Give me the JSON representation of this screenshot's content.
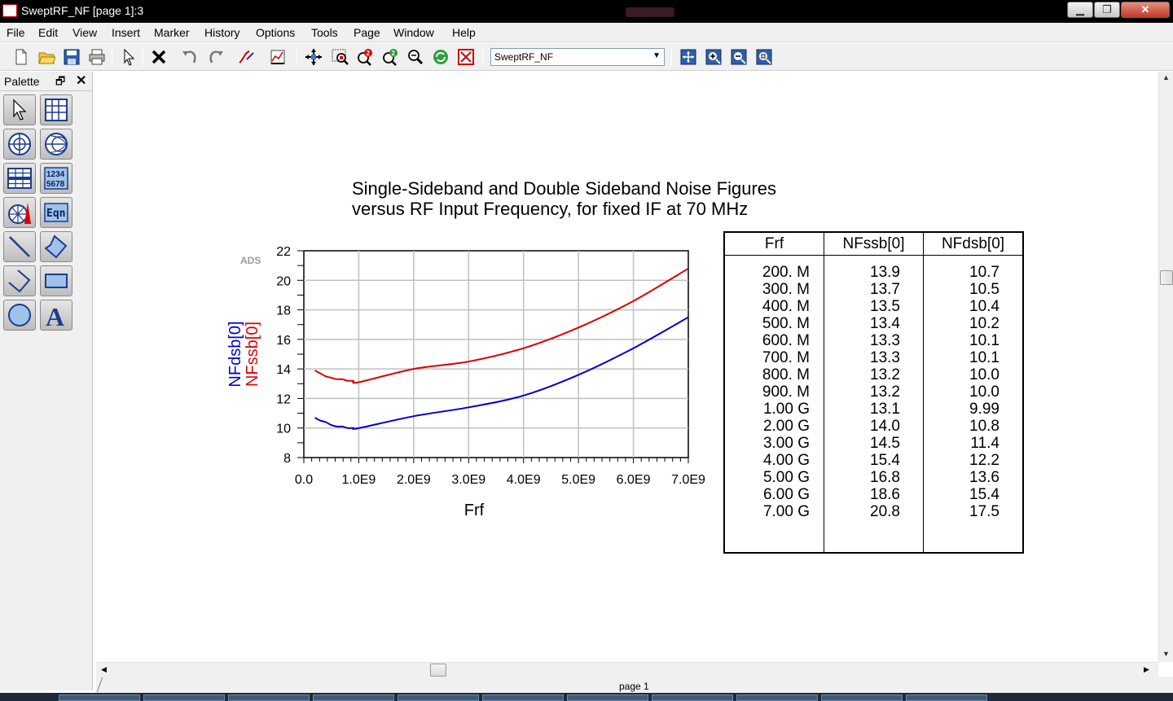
{
  "window": {
    "title": "SweptRF_NF [page 1]:3",
    "minimize": "▁",
    "maximize": "❐",
    "close": "✕"
  },
  "menu": [
    "File",
    "Edit",
    "View",
    "Insert",
    "Marker",
    "History",
    "Options",
    "Tools",
    "Page",
    "Window",
    "Help"
  ],
  "toolbar": {
    "dataset_selected": "SweptRF_NF",
    "icons": [
      "new-icon",
      "open-icon",
      "save-icon",
      "print-icon",
      "select-arrow-icon",
      "delete-icon",
      "undo-icon",
      "redo-icon",
      "trace-icon",
      "plot-options-icon",
      "pan-icon",
      "zoom-window-icon",
      "zoom-in-2x-icon",
      "zoom-out-2x-icon",
      "zoom-icon",
      "refresh-icon",
      "stop-icon",
      "zoom-fit-icon",
      "zoom-plus-icon",
      "zoom-minus-icon",
      "zoom-area-icon"
    ]
  },
  "palette": {
    "title": "Palette",
    "pin": "🗗",
    "close": "✕",
    "tools": [
      "select-tool",
      "rectangular-plot",
      "polar-plot",
      "smith-chart",
      "stacked-plot",
      "list-table",
      "antenna-plot",
      "equation",
      "line-tool",
      "polygon-tool",
      "polyline-tool",
      "rectangle-tool",
      "circle-tool",
      "text-tool"
    ],
    "list_label_top": "1234",
    "list_label_bottom": "5678",
    "eqn_label": "Eqn",
    "text_label": "A"
  },
  "chart_data": {
    "type": "line",
    "title_line1": "Single-Sideband and Double Sideband Noise Figures",
    "title_line2": "versus RF Input Frequency, for fixed IF at 70 MHz",
    "watermark": "ADS",
    "xlabel": "Frf",
    "ylabel_series": [
      "NFdsb[0]",
      "NFssb[0]"
    ],
    "xlim": [
      0,
      7000000000
    ],
    "ylim": [
      8,
      22
    ],
    "x_ticks": [
      "0.0",
      "1.0E9",
      "2.0E9",
      "3.0E9",
      "4.0E9",
      "5.0E9",
      "6.0E9",
      "7.0E9"
    ],
    "y_ticks": [
      "8",
      "10",
      "12",
      "14",
      "16",
      "18",
      "20",
      "22"
    ],
    "x": [
      200000000,
      300000000,
      400000000,
      500000000,
      600000000,
      700000000,
      800000000,
      900000000,
      1000000000,
      2000000000,
      3000000000,
      4000000000,
      5000000000,
      6000000000,
      7000000000
    ],
    "series": [
      {
        "name": "NFssb[0]",
        "color": "#dd0000",
        "values": [
          13.9,
          13.7,
          13.5,
          13.4,
          13.3,
          13.3,
          13.2,
          13.2,
          13.1,
          14.0,
          14.5,
          15.4,
          16.8,
          18.6,
          20.8
        ]
      },
      {
        "name": "NFdsb[0]",
        "color": "#0000cc",
        "values": [
          10.7,
          10.5,
          10.4,
          10.2,
          10.1,
          10.1,
          10.0,
          10.0,
          9.99,
          10.8,
          11.4,
          12.2,
          13.6,
          15.4,
          17.5
        ]
      }
    ],
    "grid": true
  },
  "table": {
    "headers": [
      "Frf",
      "NFssb[0]",
      "NFdsb[0]"
    ],
    "rows": [
      [
        "200. M",
        "13.9",
        "10.7"
      ],
      [
        "300. M",
        "13.7",
        "10.5"
      ],
      [
        "400. M",
        "13.5",
        "10.4"
      ],
      [
        "500. M",
        "13.4",
        "10.2"
      ],
      [
        "600. M",
        "13.3",
        "10.1"
      ],
      [
        "700. M",
        "13.3",
        "10.1"
      ],
      [
        "800. M",
        "13.2",
        "10.0"
      ],
      [
        "900. M",
        "13.2",
        "10.0"
      ],
      [
        "1.00 G",
        "13.1",
        "9.99"
      ],
      [
        "2.00 G",
        "14.0",
        "10.8"
      ],
      [
        "3.00 G",
        "14.5",
        "11.4"
      ],
      [
        "4.00 G",
        "15.4",
        "12.2"
      ],
      [
        "5.00 G",
        "16.8",
        "13.6"
      ],
      [
        "6.00 G",
        "18.6",
        "15.4"
      ],
      [
        "7.00 G",
        "20.8",
        "17.5"
      ]
    ]
  },
  "status": {
    "page": "page 1"
  }
}
